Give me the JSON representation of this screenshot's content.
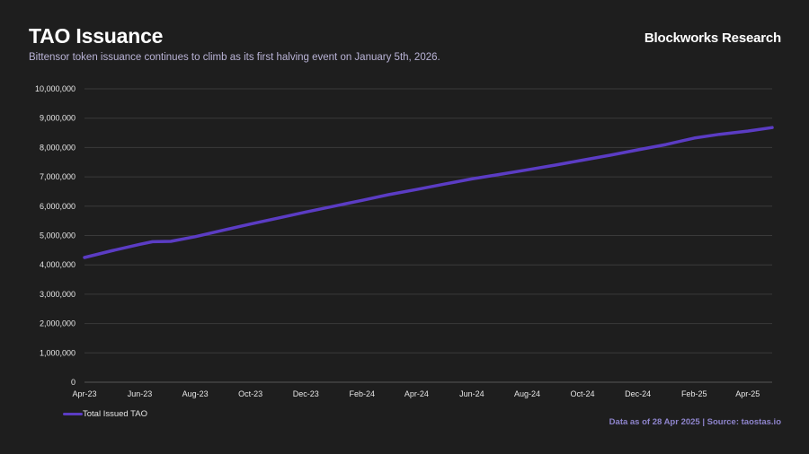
{
  "header": {
    "title": "TAO Issuance",
    "subtitle": "Bittensor token issuance continues to climb as its first halving event on January 5th, 2026.",
    "brand": "Blockworks Research"
  },
  "footer": {
    "source": "Data as of 28 Apr 2025 | Source: taostas.io"
  },
  "colors": {
    "background": "#1e1e1e",
    "line": "#5b3cc4",
    "grid": "#3a3a3a",
    "source_text": "#8e84cc"
  },
  "chart_data": {
    "type": "line",
    "title": "TAO Issuance",
    "xlabel": "",
    "ylabel": "",
    "x_tick_labels": [
      "Apr-23",
      "Jun-23",
      "Aug-23",
      "Oct-23",
      "Dec-23",
      "Feb-24",
      "Apr-24",
      "Jun-24",
      "Aug-24",
      "Oct-24",
      "Dec-24",
      "Feb-25",
      "Apr-25"
    ],
    "x_tick_dates": [
      "2023-04-01",
      "2023-06-01",
      "2023-08-01",
      "2023-10-01",
      "2023-12-01",
      "2024-02-01",
      "2024-04-01",
      "2024-06-01",
      "2024-08-01",
      "2024-10-01",
      "2024-12-01",
      "2025-02-01",
      "2025-04-01"
    ],
    "x_range": [
      "2023-04-01",
      "2025-04-28"
    ],
    "y_tick_labels": [
      "0",
      "1,000,000",
      "2,000,000",
      "3,000,000",
      "4,000,000",
      "5,000,000",
      "6,000,000",
      "7,000,000",
      "8,000,000",
      "9,000,000",
      "10,000,000"
    ],
    "ylim": [
      0,
      10000000
    ],
    "grid": true,
    "legend_position": "bottom-left",
    "series": [
      {
        "name": "Total Issued TAO",
        "points": [
          [
            "2023-04-01",
            4250000
          ],
          [
            "2023-05-01",
            4480000
          ],
          [
            "2023-06-01",
            4700000
          ],
          [
            "2023-06-15",
            4790000
          ],
          [
            "2023-07-05",
            4800000
          ],
          [
            "2023-08-01",
            4960000
          ],
          [
            "2023-09-01",
            5180000
          ],
          [
            "2023-10-01",
            5390000
          ],
          [
            "2023-11-01",
            5600000
          ],
          [
            "2023-12-01",
            5800000
          ],
          [
            "2024-01-01",
            6000000
          ],
          [
            "2024-02-01",
            6200000
          ],
          [
            "2024-03-01",
            6390000
          ],
          [
            "2024-04-01",
            6570000
          ],
          [
            "2024-05-01",
            6750000
          ],
          [
            "2024-06-01",
            6930000
          ],
          [
            "2024-07-01",
            7080000
          ],
          [
            "2024-08-01",
            7240000
          ],
          [
            "2024-09-01",
            7400000
          ],
          [
            "2024-10-01",
            7570000
          ],
          [
            "2024-11-01",
            7740000
          ],
          [
            "2024-12-01",
            7920000
          ],
          [
            "2025-01-01",
            8100000
          ],
          [
            "2025-02-01",
            8320000
          ],
          [
            "2025-03-01",
            8450000
          ],
          [
            "2025-04-01",
            8560000
          ],
          [
            "2025-04-28",
            8680000
          ]
        ]
      }
    ]
  }
}
